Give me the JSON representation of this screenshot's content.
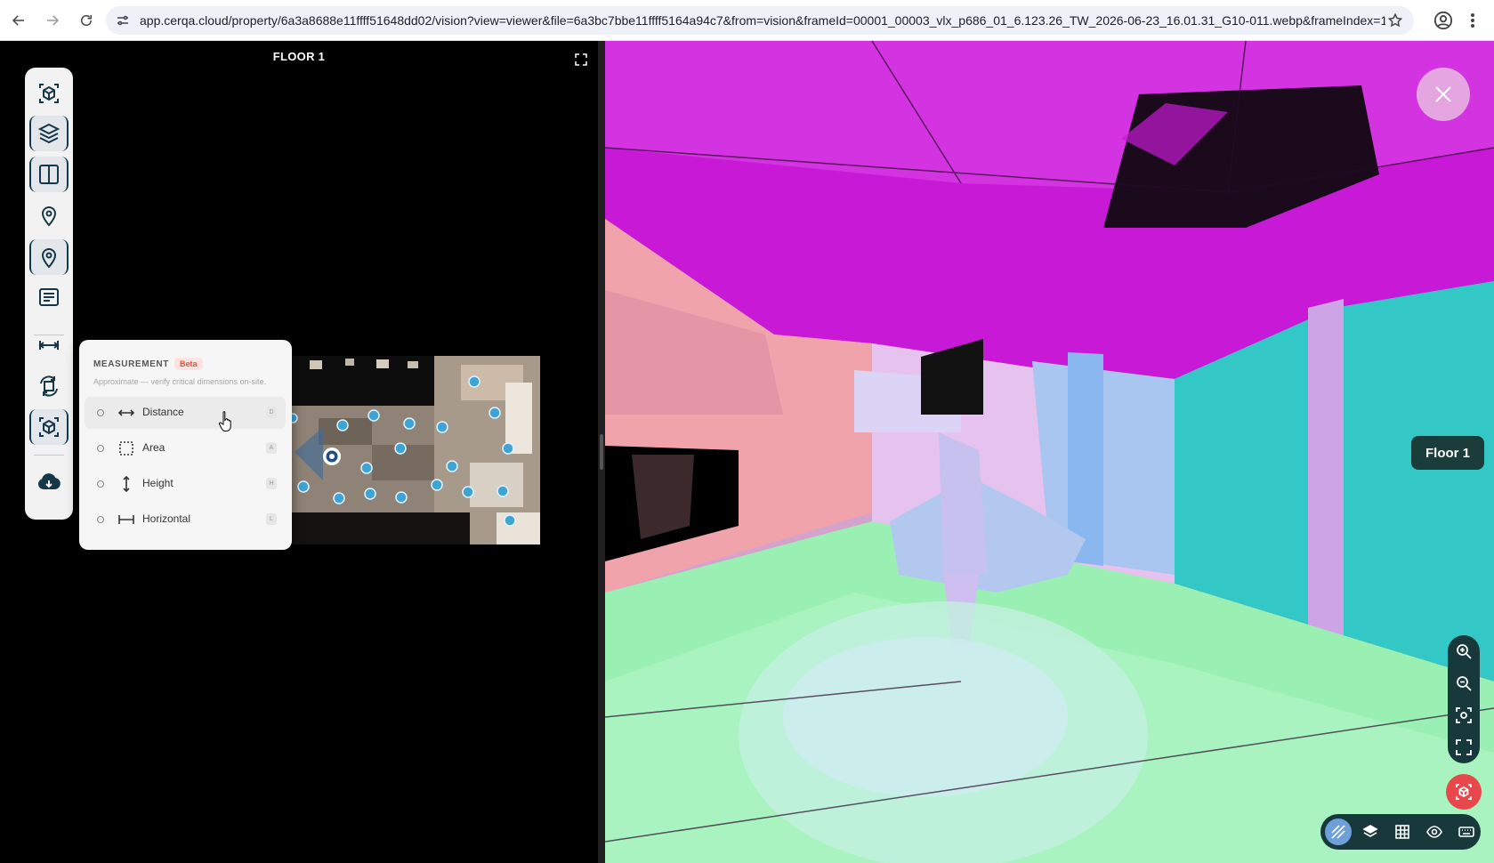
{
  "browser": {
    "url": "app.cerqa.cloud/property/6a3a8688e11ffff51648dd02/vision?view=viewer&file=6a3bc7bbe11ffff5164a94c7&from=vision&frameId=00001_00003_vlx_p686_01_6.123.26_TW_2026-06-23_16.01.31_G10-011.webp&frameIndex=1"
  },
  "plan": {
    "title": "FLOOR 1"
  },
  "toolbar": {
    "items": [
      "cube-icon",
      "layers-icon",
      "split-view-icon",
      "pin-icon",
      "pin-active-icon",
      "notes-icon",
      "measure-icon",
      "rotate-icon",
      "cube-scan-icon",
      "cloud-download-icon"
    ]
  },
  "measurement": {
    "title": "MEASUREMENT",
    "badge": "Beta",
    "subtitle": "Approximate — verify critical dimensions on-site.",
    "items": [
      {
        "label": "Distance",
        "key": "D",
        "icon": "distance-icon"
      },
      {
        "label": "Area",
        "key": "A",
        "icon": "area-icon"
      },
      {
        "label": "Height",
        "key": "H",
        "icon": "height-icon"
      },
      {
        "label": "Horizontal",
        "key": "L",
        "icon": "horizontal-icon"
      }
    ]
  },
  "viewer": {
    "floor_badge": "Floor 1"
  }
}
